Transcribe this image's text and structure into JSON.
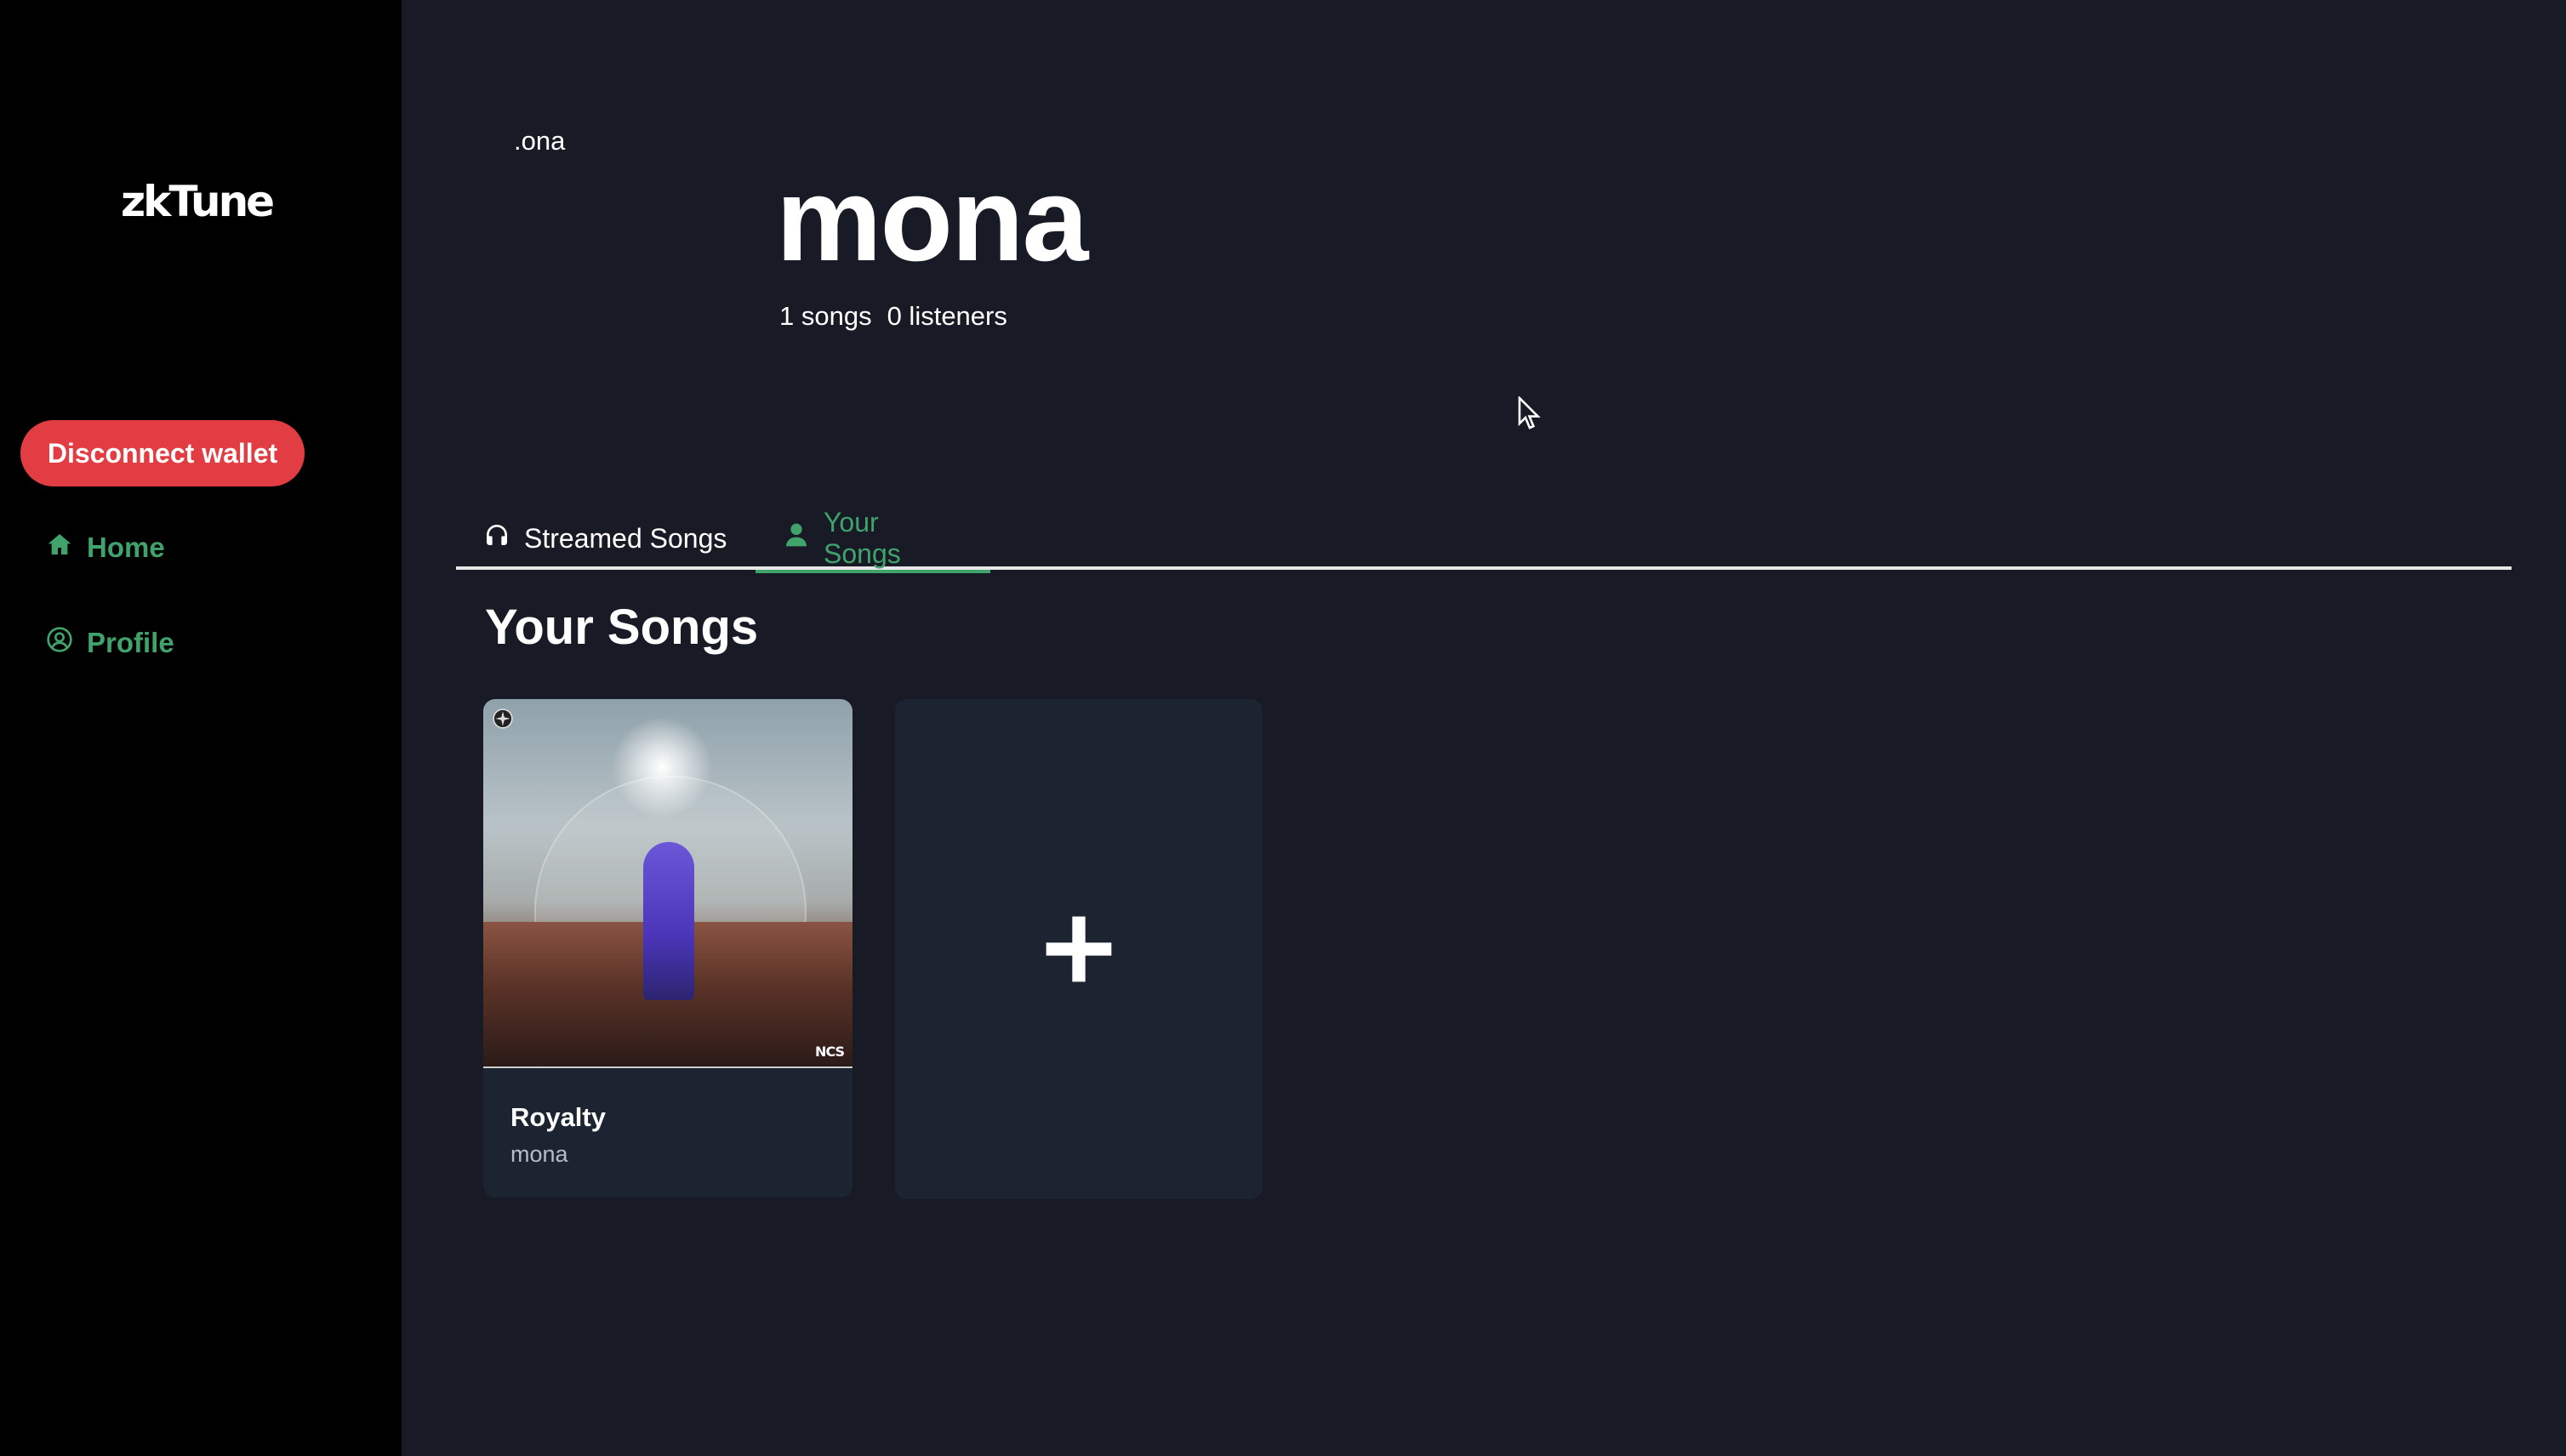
{
  "app": {
    "logo_text": "zkTune",
    "accent_color": "#3fa36b",
    "danger_color": "#e33d44"
  },
  "sidebar": {
    "disconnect_label": "Disconnect wallet",
    "items": [
      {
        "label": "Home",
        "icon": "home-icon"
      },
      {
        "label": "Profile",
        "icon": "user-circle-icon"
      }
    ]
  },
  "profile": {
    "avatar_alt": ".ona",
    "name": "mona",
    "songs_count": "1 songs",
    "listeners_count": "0 listeners"
  },
  "tabs": [
    {
      "label": "Streamed Songs",
      "icon": "headphones-icon",
      "active": false
    },
    {
      "label": "Your Songs",
      "icon": "user-icon",
      "active": true
    }
  ],
  "section": {
    "title": "Your Songs"
  },
  "songs": [
    {
      "title": "Royalty",
      "artist": "mona",
      "cover_label": "NCS"
    }
  ],
  "add_card": {
    "icon": "plus-icon"
  }
}
